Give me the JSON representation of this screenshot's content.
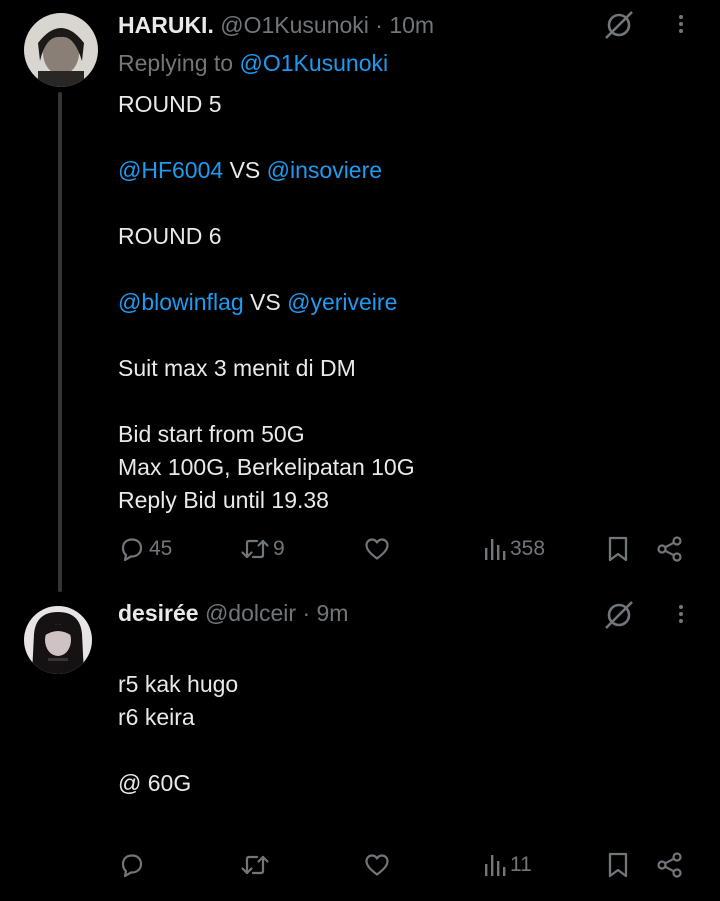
{
  "tweets": [
    {
      "display_name": "HARUKI.",
      "handle": "@O1Kusunoki",
      "separator": "·",
      "time": "10m",
      "reply_prefix": "Replying to",
      "reply_handle": "@O1Kusunoki",
      "lines": [
        {
          "text": "ROUND 5"
        },
        {
          "text": ""
        },
        {
          "mention1": "@HF6004",
          "vs": " VS ",
          "mention2": "@insoviere"
        },
        {
          "text": ""
        },
        {
          "text": "ROUND 6"
        },
        {
          "text": ""
        },
        {
          "mention1": "@blowinflag",
          "vs": " VS ",
          "mention2": "@yeriveire"
        },
        {
          "text": ""
        },
        {
          "text": "Suit max 3 menit di DM"
        },
        {
          "text": ""
        },
        {
          "text": "Bid start from 50G"
        },
        {
          "text": "Max 100G, Berkelipatan 10G"
        },
        {
          "text": "Reply Bid until 19.38"
        }
      ],
      "metrics": {
        "replies": "45",
        "reposts": "9",
        "likes": "",
        "views": "358"
      }
    },
    {
      "display_name": "desirée",
      "handle": "@dolceir",
      "separator": "·",
      "time": "9m",
      "lines": [
        {
          "text": "r5 kak hugo"
        },
        {
          "text": "r6 keira"
        },
        {
          "text": ""
        },
        {
          "text": "@ 60G"
        }
      ],
      "metrics": {
        "replies": "",
        "reposts": "",
        "likes": "",
        "views": "11"
      }
    }
  ],
  "icons": {
    "reply": "reply-icon",
    "repost": "repost-icon",
    "like": "like-icon",
    "views": "views-icon",
    "bookmark": "bookmark-icon",
    "share": "share-icon",
    "grok": "grok-icon",
    "more": "more-icon"
  },
  "colors": {
    "background": "#000000",
    "text": "#e7e9ea",
    "muted": "#71767b",
    "link": "#1d9bf0"
  }
}
